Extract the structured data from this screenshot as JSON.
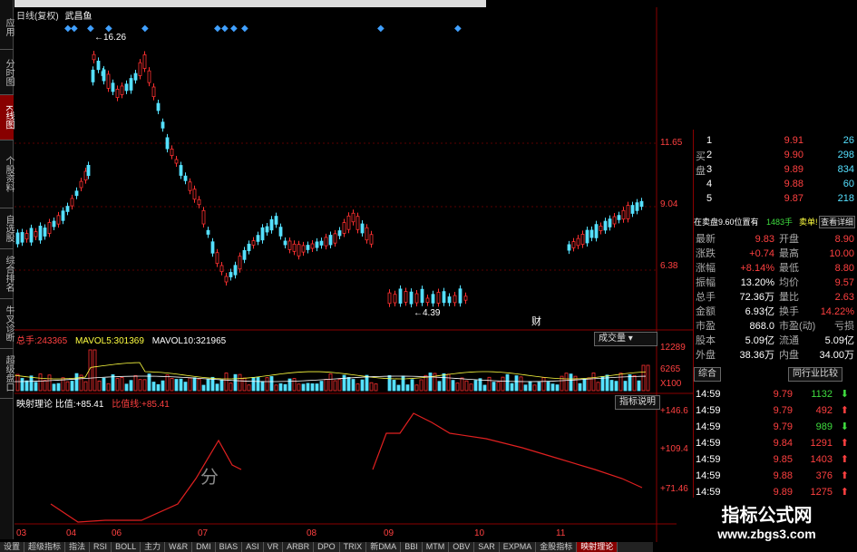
{
  "sidebar": [
    "应用",
    "分时图",
    "K线图",
    "个股资料",
    "自选股",
    "综合排名",
    "牛叉诊断",
    "超级盘口"
  ],
  "sidebar_active": 2,
  "chart_title": "日线(复权)",
  "stock_name": "武昌鱼",
  "markers": {
    "high": "16.26",
    "low": "4.39",
    "cai": "财"
  },
  "price_axis": [
    "11.65",
    "9.04",
    "6.38"
  ],
  "volume": {
    "label": "总手:",
    "total": "243365",
    "ma5_label": "MAVOL5:",
    "ma5": "301369",
    "ma10_label": "MAVOL10:",
    "ma10": "321965",
    "axis": [
      "12289",
      "6265",
      "X100"
    ],
    "dropdown": "成交量"
  },
  "indicator": {
    "name": "映射理论",
    "ratio_label": "比值:",
    "ratio": "+85.41",
    "ratio_line_label": "比值线:",
    "ratio_line": "+85.41",
    "help_btn": "指标说明",
    "axis": [
      "+146.6",
      "+109.4",
      "+71.46"
    ]
  },
  "overlay_text": "分",
  "months": [
    "03",
    "04",
    "06",
    "07",
    "08",
    "09",
    "10",
    "11"
  ],
  "orderbook": {
    "buy_side_label": "买盘",
    "rows": [
      {
        "n": "1",
        "p": "9.91",
        "v": "26"
      },
      {
        "n": "2",
        "p": "9.90",
        "v": "298"
      },
      {
        "n": "3",
        "p": "9.89",
        "v": "834"
      },
      {
        "n": "4",
        "p": "9.88",
        "v": "60"
      },
      {
        "n": "5",
        "p": "9.87",
        "v": "218"
      }
    ],
    "info": "在卖盘9.60位置有",
    "info_vol": "1483手",
    "info_tail": "卖单!",
    "detail_btn": "查看详细"
  },
  "quote": [
    {
      "l": "最新",
      "v": "9.83",
      "l2": "开盘",
      "v2": "8.90"
    },
    {
      "l": "涨跌",
      "v": "+0.74",
      "l2": "最高",
      "v2": "10.00"
    },
    {
      "l": "涨幅",
      "v": "+8.14%",
      "l2": "最低",
      "v2": "8.80"
    },
    {
      "l": "振幅",
      "v": "13.20%",
      "l2": "均价",
      "v2": "9.57"
    },
    {
      "l": "总手",
      "v": "72.36万",
      "l2": "量比",
      "v2": "2.63"
    },
    {
      "l": "金额",
      "v": "6.93亿",
      "l2": "换手",
      "v2": "14.22%"
    },
    {
      "l": "市盈",
      "v": "868.0",
      "l2": "市盈(动)",
      "v2": "亏损"
    },
    {
      "l": "股本",
      "v": "5.09亿",
      "l2": "流通",
      "v2": "5.09亿"
    },
    {
      "l": "外盘",
      "v": "38.36万",
      "l2": "内盘",
      "v2": "34.00万"
    }
  ],
  "tabs_right": {
    "t1": "综合",
    "t2": "同行业比较"
  },
  "ticks": [
    {
      "t": "14:59",
      "p": "9.79",
      "v": "1132",
      "d": "down"
    },
    {
      "t": "14:59",
      "p": "9.79",
      "v": "492",
      "d": "up"
    },
    {
      "t": "14:59",
      "p": "9.79",
      "v": "989",
      "d": "down"
    },
    {
      "t": "14:59",
      "p": "9.84",
      "v": "1291",
      "d": "up"
    },
    {
      "t": "14:59",
      "p": "9.85",
      "v": "1403",
      "d": "up"
    },
    {
      "t": "14:59",
      "p": "9.88",
      "v": "376",
      "d": "up"
    },
    {
      "t": "14:59",
      "p": "9.89",
      "v": "1275",
      "d": "up"
    }
  ],
  "bottom_tabs": [
    "设置",
    "超级指标",
    "指法",
    "RSI",
    "BOLL",
    "主力",
    "W&R",
    "DMI",
    "BIAS",
    "ASI",
    "VR",
    "ARBR",
    "DPO",
    "TRIX",
    "新DMA",
    "BBI",
    "MTM",
    "OBV",
    "SAR",
    "EXPMA",
    "金股指标",
    "映射理论"
  ],
  "watermark": {
    "title": "指标公式网",
    "url": "www.zbgs3.com"
  }
}
